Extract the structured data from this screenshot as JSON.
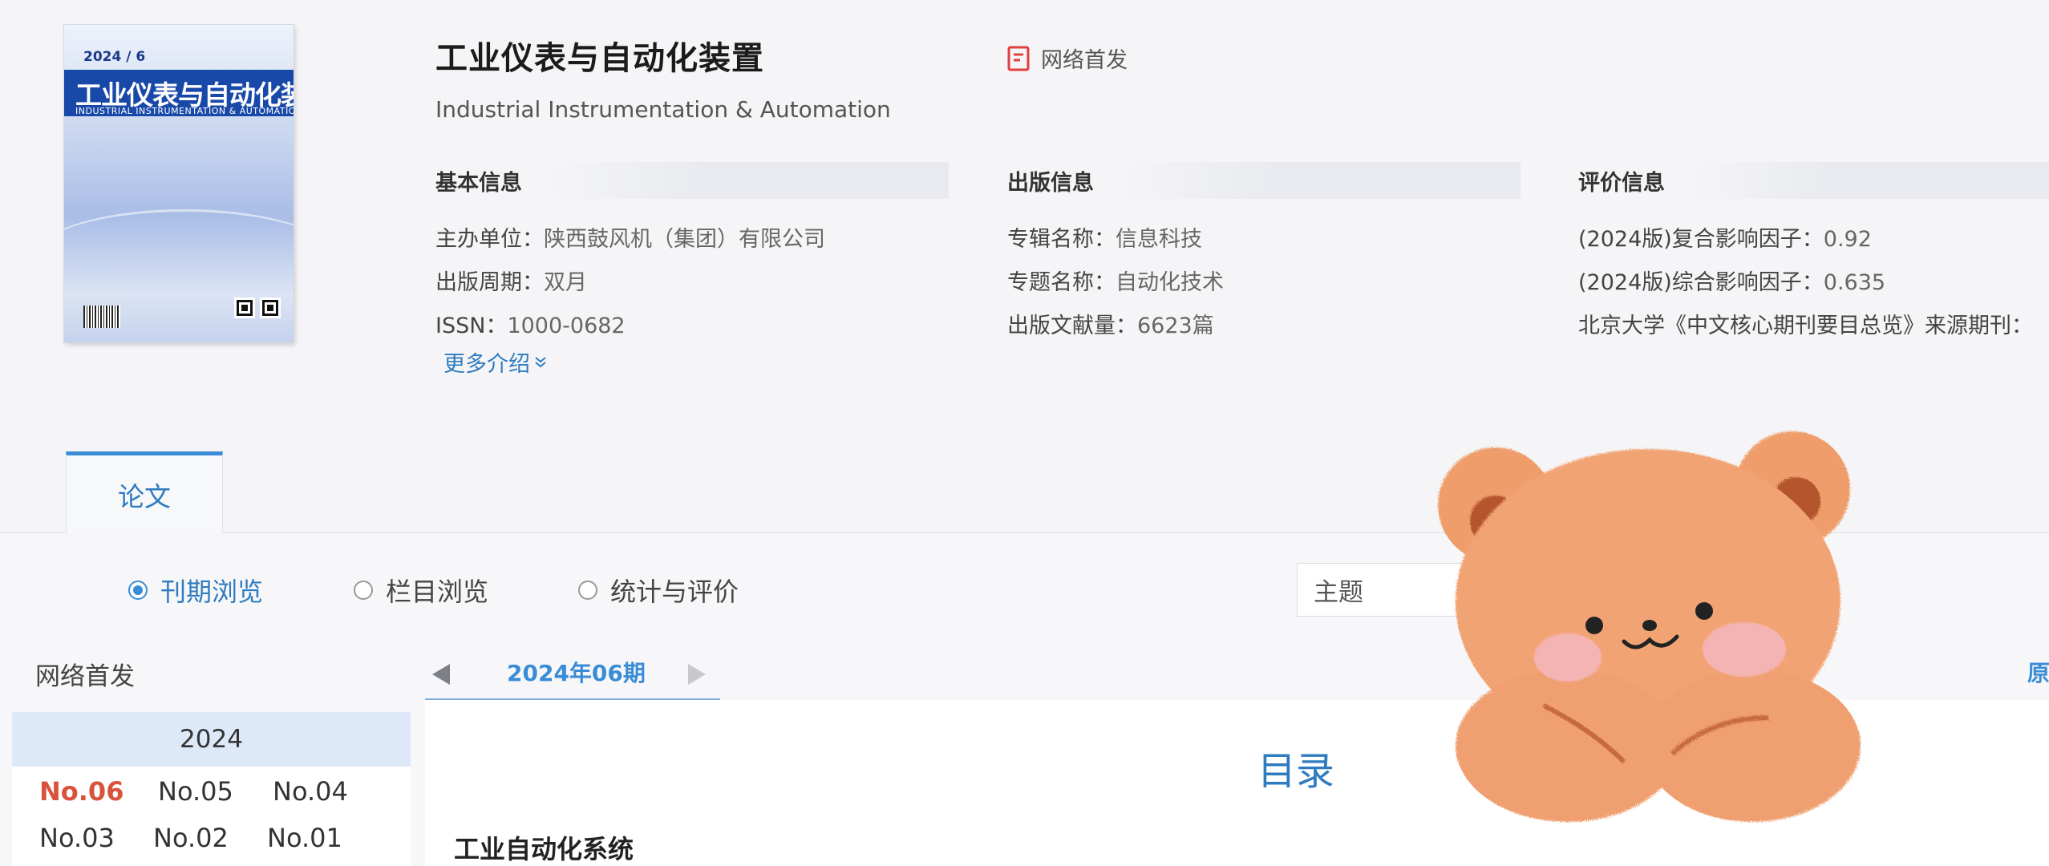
{
  "cover": {
    "issue": "2024 / 6",
    "title": "工业仪表与自动化装置",
    "subtitle": "INDUSTRIAL INSTRUMENTATION & AUTOMATION"
  },
  "journal": {
    "title": "工业仪表与自动化装置",
    "title_en": "Industrial Instrumentation & Automation",
    "online_tag": "网络首发"
  },
  "basic_info": {
    "heading": "基本信息",
    "rows": [
      {
        "label": "主办单位：",
        "value": "陕西鼓风机（集团）有限公司"
      },
      {
        "label": "出版周期：",
        "value": "双月"
      },
      {
        "label": "ISSN：",
        "value": "1000-0682"
      }
    ],
    "more": "更多介绍"
  },
  "publish_info": {
    "heading": "出版信息",
    "rows": [
      {
        "label": "专辑名称：",
        "value": "信息科技"
      },
      {
        "label": "专题名称：",
        "value": "自动化技术"
      },
      {
        "label": "出版文献量：",
        "value": "6623篇"
      }
    ]
  },
  "eval_info": {
    "heading": "评价信息",
    "rows": [
      {
        "label": "(2024版)复合影响因子：",
        "value": "0.92"
      },
      {
        "label": "(2024版)综合影响因子：",
        "value": "0.635"
      },
      {
        "label": "北京大学《中文核心期刊要目总览》来源期刊：",
        "value": ""
      }
    ]
  },
  "tabs": {
    "paper": "论文"
  },
  "browse_modes": [
    {
      "label": "刊期浏览",
      "selected": true
    },
    {
      "label": "栏目浏览",
      "selected": false
    },
    {
      "label": "统计与评价",
      "selected": false
    }
  ],
  "search": {
    "field": "主题"
  },
  "sidebar": {
    "online_label": "网络首发",
    "year": "2024",
    "issues": [
      "No.06",
      "No.05",
      "No.04",
      "No.03",
      "No.02",
      "No.01"
    ],
    "active_issue": "No.06"
  },
  "issue_nav": {
    "current": "2024年06期",
    "orig_link": "原"
  },
  "toc": {
    "title": "目录",
    "section": "工业自动化系统"
  },
  "colors": {
    "accent": "#3a8cd6",
    "active_issue": "#d9533c",
    "cover_band": "#1848a8"
  }
}
